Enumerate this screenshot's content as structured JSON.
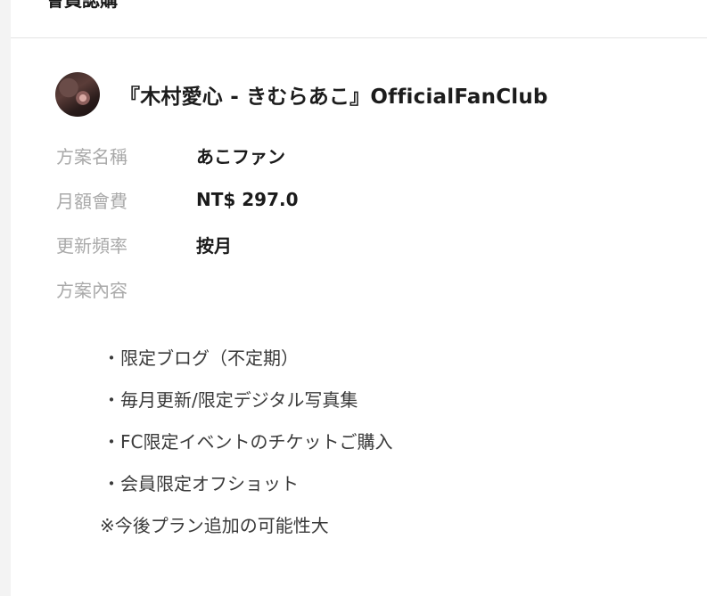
{
  "header": {
    "title": "會員認購"
  },
  "creator": {
    "name": "『木村愛心 - きむらあこ』OfficialFanClub",
    "avatar_icon": "creator-avatar-photo"
  },
  "plan": {
    "fields": [
      {
        "label": "方案名稱",
        "value": "あこファン"
      },
      {
        "label": "月額會費",
        "value": "NT$ 297.0"
      },
      {
        "label": "更新頻率",
        "value": "按月"
      },
      {
        "label": "方案內容",
        "value": ""
      }
    ],
    "content_lines": [
      "・限定ブログ（不定期）",
      "・毎月更新/限定デジタル写真集",
      "・FC限定イベントのチケットご購入",
      "・会員限定オフショット",
      "※今後プラン追加の可能性大"
    ]
  }
}
